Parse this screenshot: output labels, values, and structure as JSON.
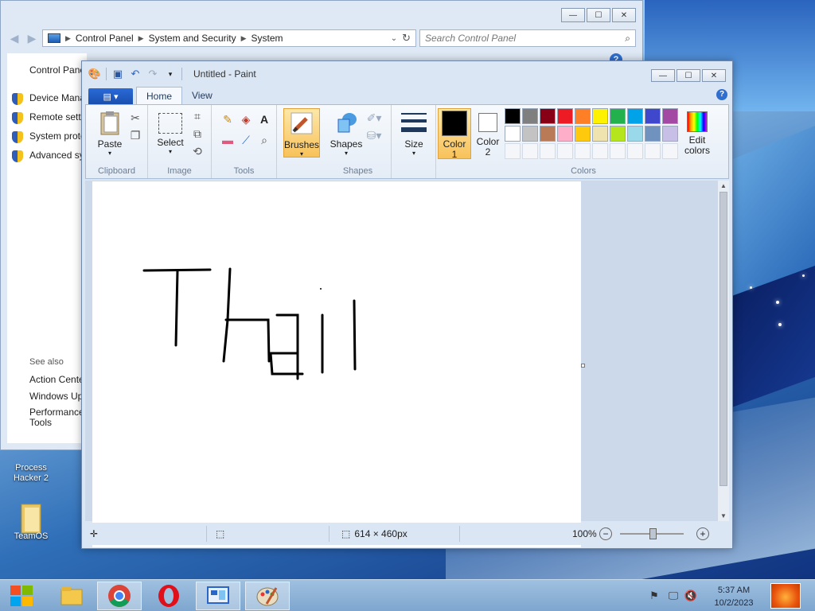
{
  "desktop": {
    "icons": [
      {
        "label": "Process Hacker 2"
      },
      {
        "label": "TeamOS"
      }
    ]
  },
  "control_panel": {
    "address": {
      "crumbs": [
        "Control Panel",
        "System and Security",
        "System"
      ]
    },
    "search": {
      "placeholder": "Search Control Panel"
    },
    "sidebar": {
      "home": "Control Pane",
      "links": [
        "Device Mana",
        "Remote setti",
        "System prote",
        "Advanced sys"
      ],
      "see_also": "See also",
      "see_also_links": [
        "Action Cente",
        "Windows Up",
        "Performance Tools"
      ]
    }
  },
  "paint": {
    "title": "Untitled - Paint",
    "tabs": {
      "home": "Home",
      "view": "View"
    },
    "ribbon": {
      "clipboard": {
        "label": "Clipboard",
        "paste": "Paste"
      },
      "image": {
        "label": "Image",
        "select": "Select"
      },
      "tools": {
        "label": "Tools"
      },
      "brushes": "Brushes",
      "shapes": {
        "label": "Shapes",
        "button": "Shapes"
      },
      "size": "Size",
      "colors": {
        "label": "Colors",
        "color1": "Color 1",
        "color2": "Color 2",
        "edit": "Edit colors",
        "color1_value": "#000000",
        "color2_value": "#ffffff",
        "palette": [
          "#000000",
          "#7f7f7f",
          "#880015",
          "#ed1c24",
          "#ff7f27",
          "#fff200",
          "#22b14c",
          "#00a2e8",
          "#3f48cc",
          "#a349a4",
          "#ffffff",
          "#c3c3c3",
          "#b97a57",
          "#ffaec9",
          "#ffc90e",
          "#efe4b0",
          "#b5e61d",
          "#99d9ea",
          "#7092be",
          "#c8bfe7"
        ]
      }
    },
    "status": {
      "dimensions": "614 × 460px",
      "zoom": "100%"
    }
  },
  "taskbar": {
    "clock_time": "5:37 AM",
    "clock_date": "10/2/2023"
  }
}
